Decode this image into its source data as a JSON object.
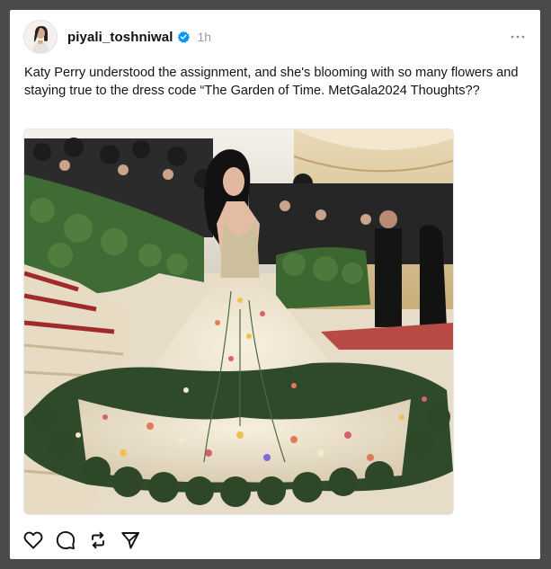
{
  "post": {
    "author": {
      "username": "piyali_toshniwal",
      "verified": true,
      "avatar_icon": "profile-photo"
    },
    "timestamp": "1h",
    "caption": "Katy Perry understood the assignment, and she's blooming with so many flowers and staying true to the dress code “The Garden of Time. MetGala2024 Thoughts??",
    "image_description_icon": "gown-photo",
    "menu_icon": "more-horizontal-icon",
    "actions": [
      {
        "name": "like",
        "icon": "heart-icon"
      },
      {
        "name": "comment",
        "icon": "comment-icon"
      },
      {
        "name": "repost",
        "icon": "repost-icon"
      },
      {
        "name": "share",
        "icon": "send-icon"
      }
    ]
  },
  "colors": {
    "background": "#4a4a4a",
    "card": "#ffffff",
    "verified": "#0095f6",
    "text": "#141414",
    "muted": "#9b9b9b"
  }
}
